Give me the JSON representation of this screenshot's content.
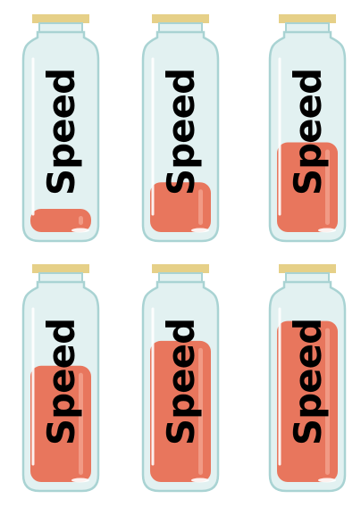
{
  "jars": [
    {
      "label": "Speed",
      "fill_level": 0.14
    },
    {
      "label": "Speed",
      "fill_level": 0.3
    },
    {
      "label": "Speed",
      "fill_level": 0.54
    },
    {
      "label": "Speed",
      "fill_level": 0.7
    },
    {
      "label": "Speed",
      "fill_level": 0.85
    },
    {
      "label": "Speed",
      "fill_level": 0.97
    }
  ],
  "colors": {
    "lid": "#e6d088",
    "glass": "#e2f1f1",
    "glass_outline": "#a9d3d3",
    "glass_highlight": "#ffffff",
    "liquid": "#e8765d",
    "liquid_highlight": "#f19a85",
    "text": "#000000"
  }
}
